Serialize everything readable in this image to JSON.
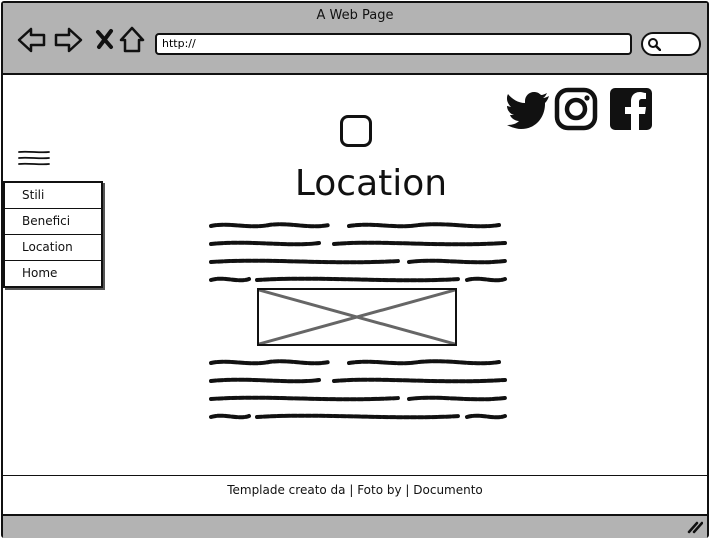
{
  "window": {
    "title": "A Web Page"
  },
  "browser": {
    "url": "http://",
    "icons": [
      "back-arrow-icon",
      "forward-arrow-icon",
      "close-x-icon",
      "home-icon",
      "search-icon"
    ]
  },
  "social": [
    "twitter-icon",
    "instagram-icon",
    "facebook-icon"
  ],
  "page": {
    "heading": "Location"
  },
  "menu": {
    "items": [
      {
        "label": "Stili"
      },
      {
        "label": "Benefici"
      },
      {
        "label": "Location"
      },
      {
        "label": "Home"
      }
    ]
  },
  "footer": {
    "text": "Templade creato da | Foto by | Documento"
  },
  "colors": {
    "chrome": "#b3b3b3",
    "ink": "#111111"
  }
}
